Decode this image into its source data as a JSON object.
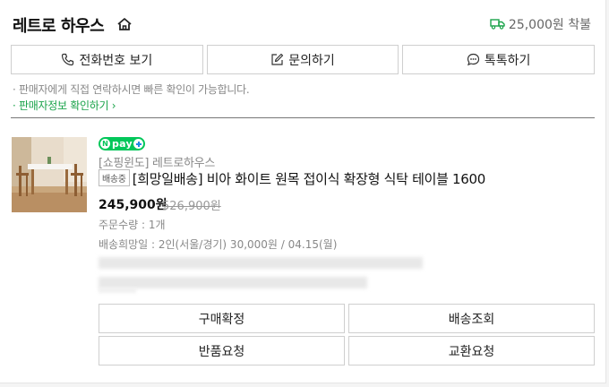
{
  "store": {
    "name": "레트로 하우스",
    "icon": "home-icon",
    "shipping_fee": "25,000원 착불",
    "shipping_icon": "truck-icon",
    "accent_color": "#1aa34a"
  },
  "contact_buttons": [
    {
      "label": "전화번호 보기",
      "icon": "phone-icon"
    },
    {
      "label": "문의하기",
      "icon": "edit-icon"
    },
    {
      "label": "톡톡하기",
      "icon": "chat-icon"
    }
  ],
  "notice": "· 판매자에게 직접 연락하시면 빠른 확인이 가능합니다.",
  "seller_info_link": "· 판매자정보 확인하기 ›",
  "order": {
    "npay_badge": "pay",
    "category": "[쇼핑윈도] 레트로하우스",
    "status_badge": "배송중",
    "title": "[희망일배송] 비아 화이트 원목 접이식 확장형 식탁 테이블 1600",
    "price": "245,900원",
    "original_price": "526,900원",
    "quantity": "주문수량 : 1개",
    "delivery_request": "배송희망일 : 2인(서울/경기) 30,000원 / 04.15(월)"
  },
  "actions": [
    {
      "label": "구매확정"
    },
    {
      "label": "배송조회"
    },
    {
      "label": "반품요청"
    },
    {
      "label": "교환요청"
    }
  ]
}
